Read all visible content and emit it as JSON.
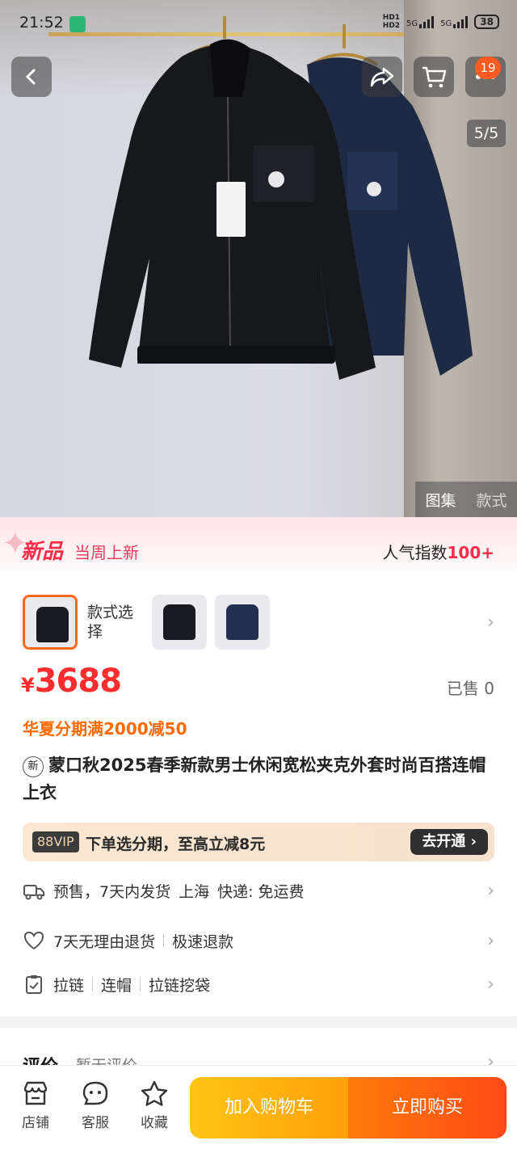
{
  "status_bar": {
    "time": "21:52",
    "network_1": "HD1",
    "network_2": "HD2",
    "signal_1": "5G",
    "signal_2": "5G",
    "battery": "38"
  },
  "gallery": {
    "page_indicator": "5/5",
    "tabs": [
      "图集",
      "款式"
    ],
    "cart_badge": "19"
  },
  "new_arrival": {
    "tag": "新品",
    "subtitle": "当周上新",
    "popularity_label": "人气指数",
    "popularity_value": "100+"
  },
  "variants": {
    "label": "款式选择",
    "colors": [
      "black",
      "black",
      "navy"
    ]
  },
  "price": {
    "currency": "¥",
    "amount": "3688",
    "sold": "已售 0"
  },
  "promo": "华夏分期满2000减50",
  "product": {
    "new_badge": "新",
    "title": "蒙口秋2025春季新款男士休闲宽松夹克外套时尚百搭连帽上衣"
  },
  "vip": {
    "chip": "88VIP",
    "text": "下单选分期，至高立减8元",
    "button": "去开通"
  },
  "shipping": {
    "text": "预售，7天内发货",
    "origin": "上海",
    "courier": "快递: 免运费"
  },
  "service": {
    "returns": "7天无理由退货",
    "refund": "极速退款"
  },
  "attributes": [
    "拉链",
    "连帽",
    "拉链挖袋"
  ],
  "reviews": {
    "title": "评价",
    "status": "暂无评价"
  },
  "bottom_bar": {
    "shop": "店铺",
    "service": "客服",
    "favorite": "收藏",
    "add_to_cart": "加入购物车",
    "buy_now": "立即购买"
  },
  "colors": {
    "accent": "#ff2d2d",
    "promo": "#ff6a00",
    "cart_button": "#ffb30f",
    "buy_button": "#ff5a12"
  }
}
